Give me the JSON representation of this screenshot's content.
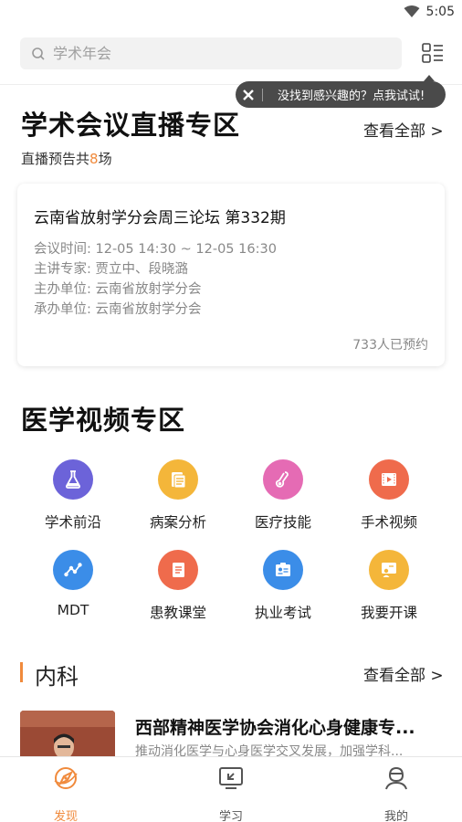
{
  "status_bar": {
    "time": "5:05"
  },
  "search": {
    "placeholder": "学术年会"
  },
  "tooltip": {
    "text": "没找到感兴趣的？点我试试!"
  },
  "live_section": {
    "title": "学术会议直播专区",
    "view_all": "查看全部 >",
    "preview_prefix": "直播预告共",
    "preview_count": "8",
    "preview_suffix": "场",
    "card": {
      "title": "云南省放射学分会周三论坛 第332期",
      "time": "会议时间:  12-05 14:30 ~ 12-05 16:30",
      "experts": "主讲专家:  贾立中、段晓潞",
      "organizer": "主办单位:  云南省放射学分会",
      "co_organizer": "承办单位:  云南省放射学分会",
      "booked": "733人已预约"
    }
  },
  "video_section": {
    "title": "医学视频专区",
    "items": [
      {
        "label": "学术前沿",
        "icon": "flask-icon",
        "color": "#6c63d9"
      },
      {
        "label": "病案分析",
        "icon": "document-icon",
        "color": "#f4b63a"
      },
      {
        "label": "医疗技能",
        "icon": "thermometer-icon",
        "color": "#e56bb4"
      },
      {
        "label": "手术视频",
        "icon": "film-icon",
        "color": "#ef6b4c"
      },
      {
        "label": "MDT",
        "icon": "network-icon",
        "color": "#3b8de8"
      },
      {
        "label": "患教课堂",
        "icon": "notebook-icon",
        "color": "#ef6b4c"
      },
      {
        "label": "执业考试",
        "icon": "id-card-icon",
        "color": "#3b8de8"
      },
      {
        "label": "我要开课",
        "icon": "teacher-icon",
        "color": "#f4b63a"
      }
    ]
  },
  "category": {
    "title": "内科",
    "view_all": "查看全部 >",
    "video": {
      "title": "西部精神医学协会消化心身健康专...",
      "desc": "推动消化医学与心身医学交叉发展，加强学科..."
    }
  },
  "tabs": [
    {
      "label": "发现",
      "active": true
    },
    {
      "label": "学习",
      "active": false
    },
    {
      "label": "我的",
      "active": false
    }
  ],
  "colors": {
    "accent": "#f08a3c"
  }
}
